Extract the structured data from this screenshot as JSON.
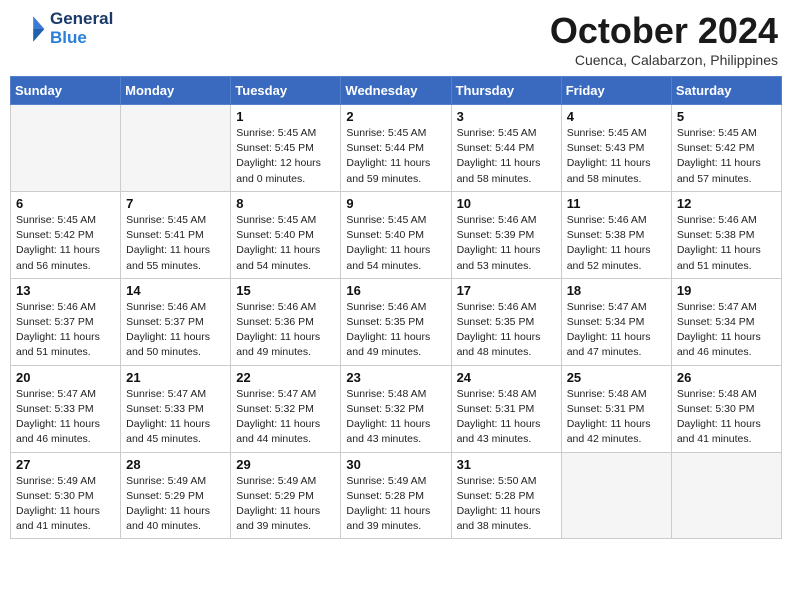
{
  "logo": {
    "line1": "General",
    "line2": "Blue"
  },
  "header": {
    "month": "October 2024",
    "location": "Cuenca, Calabarzon, Philippines"
  },
  "weekdays": [
    "Sunday",
    "Monday",
    "Tuesday",
    "Wednesday",
    "Thursday",
    "Friday",
    "Saturday"
  ],
  "weeks": [
    [
      {
        "day": "",
        "info": ""
      },
      {
        "day": "",
        "info": ""
      },
      {
        "day": "1",
        "info": "Sunrise: 5:45 AM\nSunset: 5:45 PM\nDaylight: 12 hours\nand 0 minutes."
      },
      {
        "day": "2",
        "info": "Sunrise: 5:45 AM\nSunset: 5:44 PM\nDaylight: 11 hours\nand 59 minutes."
      },
      {
        "day": "3",
        "info": "Sunrise: 5:45 AM\nSunset: 5:44 PM\nDaylight: 11 hours\nand 58 minutes."
      },
      {
        "day": "4",
        "info": "Sunrise: 5:45 AM\nSunset: 5:43 PM\nDaylight: 11 hours\nand 58 minutes."
      },
      {
        "day": "5",
        "info": "Sunrise: 5:45 AM\nSunset: 5:42 PM\nDaylight: 11 hours\nand 57 minutes."
      }
    ],
    [
      {
        "day": "6",
        "info": "Sunrise: 5:45 AM\nSunset: 5:42 PM\nDaylight: 11 hours\nand 56 minutes."
      },
      {
        "day": "7",
        "info": "Sunrise: 5:45 AM\nSunset: 5:41 PM\nDaylight: 11 hours\nand 55 minutes."
      },
      {
        "day": "8",
        "info": "Sunrise: 5:45 AM\nSunset: 5:40 PM\nDaylight: 11 hours\nand 54 minutes."
      },
      {
        "day": "9",
        "info": "Sunrise: 5:45 AM\nSunset: 5:40 PM\nDaylight: 11 hours\nand 54 minutes."
      },
      {
        "day": "10",
        "info": "Sunrise: 5:46 AM\nSunset: 5:39 PM\nDaylight: 11 hours\nand 53 minutes."
      },
      {
        "day": "11",
        "info": "Sunrise: 5:46 AM\nSunset: 5:38 PM\nDaylight: 11 hours\nand 52 minutes."
      },
      {
        "day": "12",
        "info": "Sunrise: 5:46 AM\nSunset: 5:38 PM\nDaylight: 11 hours\nand 51 minutes."
      }
    ],
    [
      {
        "day": "13",
        "info": "Sunrise: 5:46 AM\nSunset: 5:37 PM\nDaylight: 11 hours\nand 51 minutes."
      },
      {
        "day": "14",
        "info": "Sunrise: 5:46 AM\nSunset: 5:37 PM\nDaylight: 11 hours\nand 50 minutes."
      },
      {
        "day": "15",
        "info": "Sunrise: 5:46 AM\nSunset: 5:36 PM\nDaylight: 11 hours\nand 49 minutes."
      },
      {
        "day": "16",
        "info": "Sunrise: 5:46 AM\nSunset: 5:35 PM\nDaylight: 11 hours\nand 49 minutes."
      },
      {
        "day": "17",
        "info": "Sunrise: 5:46 AM\nSunset: 5:35 PM\nDaylight: 11 hours\nand 48 minutes."
      },
      {
        "day": "18",
        "info": "Sunrise: 5:47 AM\nSunset: 5:34 PM\nDaylight: 11 hours\nand 47 minutes."
      },
      {
        "day": "19",
        "info": "Sunrise: 5:47 AM\nSunset: 5:34 PM\nDaylight: 11 hours\nand 46 minutes."
      }
    ],
    [
      {
        "day": "20",
        "info": "Sunrise: 5:47 AM\nSunset: 5:33 PM\nDaylight: 11 hours\nand 46 minutes."
      },
      {
        "day": "21",
        "info": "Sunrise: 5:47 AM\nSunset: 5:33 PM\nDaylight: 11 hours\nand 45 minutes."
      },
      {
        "day": "22",
        "info": "Sunrise: 5:47 AM\nSunset: 5:32 PM\nDaylight: 11 hours\nand 44 minutes."
      },
      {
        "day": "23",
        "info": "Sunrise: 5:48 AM\nSunset: 5:32 PM\nDaylight: 11 hours\nand 43 minutes."
      },
      {
        "day": "24",
        "info": "Sunrise: 5:48 AM\nSunset: 5:31 PM\nDaylight: 11 hours\nand 43 minutes."
      },
      {
        "day": "25",
        "info": "Sunrise: 5:48 AM\nSunset: 5:31 PM\nDaylight: 11 hours\nand 42 minutes."
      },
      {
        "day": "26",
        "info": "Sunrise: 5:48 AM\nSunset: 5:30 PM\nDaylight: 11 hours\nand 41 minutes."
      }
    ],
    [
      {
        "day": "27",
        "info": "Sunrise: 5:49 AM\nSunset: 5:30 PM\nDaylight: 11 hours\nand 41 minutes."
      },
      {
        "day": "28",
        "info": "Sunrise: 5:49 AM\nSunset: 5:29 PM\nDaylight: 11 hours\nand 40 minutes."
      },
      {
        "day": "29",
        "info": "Sunrise: 5:49 AM\nSunset: 5:29 PM\nDaylight: 11 hours\nand 39 minutes."
      },
      {
        "day": "30",
        "info": "Sunrise: 5:49 AM\nSunset: 5:28 PM\nDaylight: 11 hours\nand 39 minutes."
      },
      {
        "day": "31",
        "info": "Sunrise: 5:50 AM\nSunset: 5:28 PM\nDaylight: 11 hours\nand 38 minutes."
      },
      {
        "day": "",
        "info": ""
      },
      {
        "day": "",
        "info": ""
      }
    ]
  ]
}
